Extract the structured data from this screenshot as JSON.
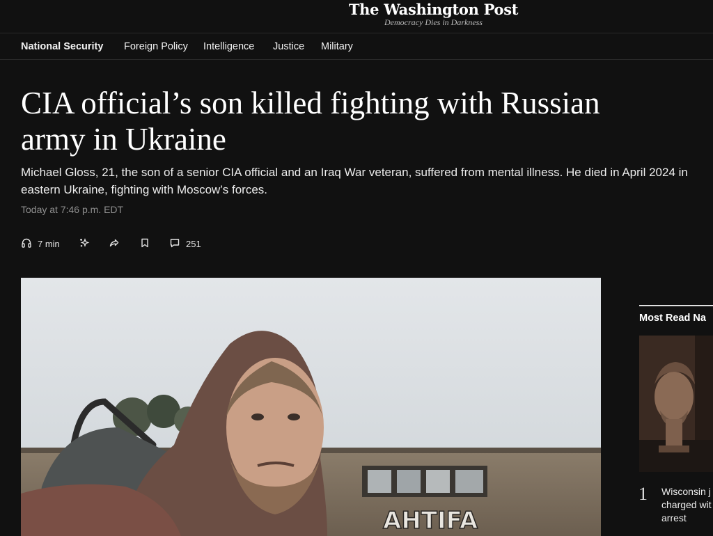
{
  "masthead": {
    "logo": "The Washington Post",
    "tagline": "Democracy Dies in Darkness"
  },
  "section_nav": {
    "items": [
      {
        "label": "National Security",
        "active": true
      },
      {
        "label": "Foreign Policy"
      },
      {
        "label": "Intelligence"
      },
      {
        "label": "Justice"
      },
      {
        "label": "Military"
      }
    ]
  },
  "article": {
    "headline": "CIA official’s son killed fighting with Russian army in Ukraine",
    "dek": "Michael Gloss, 21, the son of a senior CIA official and an Iraq War veteran, suffered from mental illness. He died in April 2024 in eastern Ukraine, fighting with Moscow’s forces.",
    "timestamp": "Today at 7:46 p.m. EDT"
  },
  "toolbar": {
    "listen": {
      "icon": "headphones-icon",
      "label": "7 min"
    },
    "summary": {
      "icon": "sparkle-icon"
    },
    "share": {
      "icon": "share-icon"
    },
    "save": {
      "icon": "bookmark-icon"
    },
    "comments": {
      "icon": "comment-icon",
      "count": "251"
    }
  },
  "lead_image": {
    "description": "Young man in a brown hooded sweatshirt with a backpack taking a selfie in front of a building with graffiti",
    "graffiti_text": "AHTIFA"
  },
  "most_read": {
    "title": "Most Read Na",
    "items": [
      {
        "rank": "1",
        "text": "Wisconsin j charged wit arrest"
      }
    ]
  }
}
